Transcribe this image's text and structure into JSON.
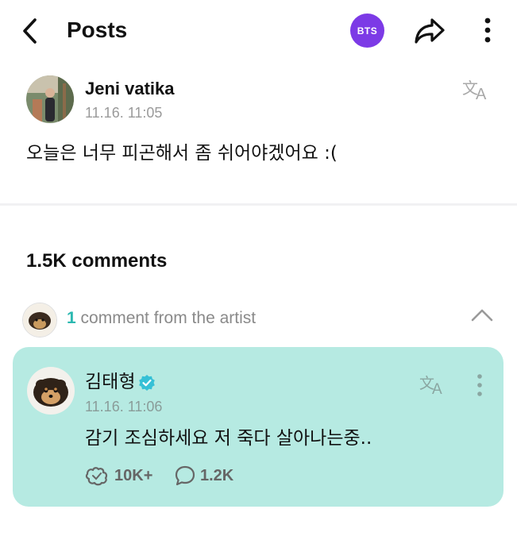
{
  "header": {
    "title": "Posts",
    "community_badge": "BTS",
    "badge_color": "#7c3ae6",
    "back_icon": "chevron-left-icon",
    "share_icon": "share-arrow-icon",
    "more_icon": "more-vertical-icon"
  },
  "post": {
    "author": "Jeni vatika",
    "time": "11.16. 11:05",
    "text": "오늘은 너무 피곤해서 좀 쉬어야겠어요 :(",
    "translate_icon": "translate-icon"
  },
  "comments": {
    "count_label": "1.5K comments",
    "artist_count": "1",
    "artist_label": "comment from the artist",
    "collapse_icon": "chevron-up-icon"
  },
  "artist_comment": {
    "name": "김태형",
    "time": "11.16. 11:06",
    "text": "감기 조심하세요 저 죽다 살아나는중..",
    "likes": "10K+",
    "replies": "1.2K",
    "card_color": "#b6eae2",
    "accent_color": "#2bb8b0",
    "verified_icon": "verified-badge-icon",
    "like_icon": "like-icon",
    "reply_icon": "comment-bubble-icon"
  }
}
